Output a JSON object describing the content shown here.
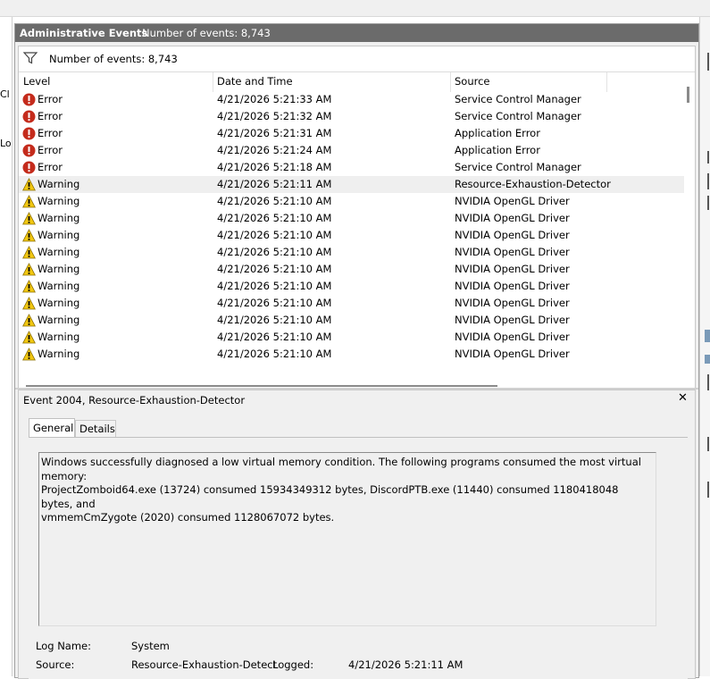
{
  "left_fragments": [
    "Cl",
    "Lo"
  ],
  "header": {
    "title": "Administrative Events",
    "event_count": "Number of events: 8,743"
  },
  "filter_bar": {
    "count_text": "Number of events: 8,743",
    "icon": "filter-funnel-icon"
  },
  "columns": [
    "Level",
    "Date and Time",
    "Source"
  ],
  "rows": [
    {
      "level": "Error",
      "date": "4/21/2026 5:21:33 AM",
      "source": "Service Control Manager",
      "icon": "error-icon"
    },
    {
      "level": "Error",
      "date": "4/21/2026 5:21:32 AM",
      "source": "Service Control Manager",
      "icon": "error-icon"
    },
    {
      "level": "Error",
      "date": "4/21/2026 5:21:31 AM",
      "source": "Application Error",
      "icon": "error-icon"
    },
    {
      "level": "Error",
      "date": "4/21/2026 5:21:24 AM",
      "source": "Application Error",
      "icon": "error-icon"
    },
    {
      "level": "Error",
      "date": "4/21/2026 5:21:18 AM",
      "source": "Service Control Manager",
      "icon": "error-icon"
    },
    {
      "level": "Warning",
      "date": "4/21/2026 5:21:11 AM",
      "source": "Resource-Exhaustion-Detector",
      "icon": "warning-icon",
      "selected": true
    },
    {
      "level": "Warning",
      "date": "4/21/2026 5:21:10 AM",
      "source": "NVIDIA OpenGL Driver",
      "icon": "warning-icon"
    },
    {
      "level": "Warning",
      "date": "4/21/2026 5:21:10 AM",
      "source": "NVIDIA OpenGL Driver",
      "icon": "warning-icon"
    },
    {
      "level": "Warning",
      "date": "4/21/2026 5:21:10 AM",
      "source": "NVIDIA OpenGL Driver",
      "icon": "warning-icon"
    },
    {
      "level": "Warning",
      "date": "4/21/2026 5:21:10 AM",
      "source": "NVIDIA OpenGL Driver",
      "icon": "warning-icon"
    },
    {
      "level": "Warning",
      "date": "4/21/2026 5:21:10 AM",
      "source": "NVIDIA OpenGL Driver",
      "icon": "warning-icon"
    },
    {
      "level": "Warning",
      "date": "4/21/2026 5:21:10 AM",
      "source": "NVIDIA OpenGL Driver",
      "icon": "warning-icon"
    },
    {
      "level": "Warning",
      "date": "4/21/2026 5:21:10 AM",
      "source": "NVIDIA OpenGL Driver",
      "icon": "warning-icon"
    },
    {
      "level": "Warning",
      "date": "4/21/2026 5:21:10 AM",
      "source": "NVIDIA OpenGL Driver",
      "icon": "warning-icon"
    },
    {
      "level": "Warning",
      "date": "4/21/2026 5:21:10 AM",
      "source": "NVIDIA OpenGL Driver",
      "icon": "warning-icon"
    },
    {
      "level": "Warning",
      "date": "4/21/2026 5:21:10 AM",
      "source": "NVIDIA OpenGL Driver",
      "icon": "warning-icon"
    }
  ],
  "detail": {
    "title": "Event 2004, Resource-Exhaustion-Detector",
    "close_icon": "close-icon",
    "tabs": [
      "General",
      "Details"
    ],
    "message": "Windows successfully diagnosed a low virtual memory condition. The following programs consumed the most virtual memory:\nProjectZomboid64.exe (13724) consumed 15934349312 bytes, DiscordPTB.exe (11440) consumed 1180418048 bytes, and\nvmmemCmZygote (2020) consumed 1128067072 bytes.",
    "fields": {
      "log_name_label": "Log Name:",
      "log_name_value": "System",
      "source_label": "Source:",
      "source_value": "Resource-Exhaustion-Detect",
      "logged_label": "Logged:",
      "logged_value": "4/21/2026 5:21:11 AM"
    }
  },
  "colors": {
    "title_bar": "#6b6b6b",
    "error_red": "#c42b1c",
    "warning_yellow": "#f2c811",
    "selected_row": "#efefef"
  }
}
